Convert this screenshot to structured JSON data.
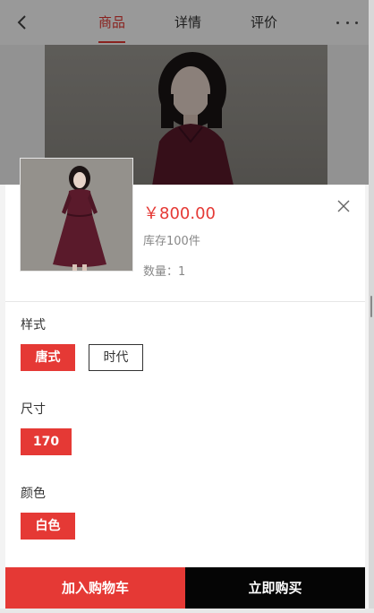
{
  "nav": {
    "tabs": [
      {
        "label": "商品",
        "active": true
      },
      {
        "label": "详情",
        "active": false
      },
      {
        "label": "评价",
        "active": false
      }
    ],
    "back_icon": "chevron-left-icon",
    "more_icon": "more-dots-icon"
  },
  "product": {
    "price": "￥800.00",
    "stock": "库存100件",
    "quantity_label": "数量：",
    "quantity_value": "1"
  },
  "sku_groups": [
    {
      "label": "样式",
      "options": [
        {
          "label": "唐式",
          "selected": true
        },
        {
          "label": "时代",
          "selected": false
        }
      ]
    },
    {
      "label": "尺寸",
      "options": [
        {
          "label": "170",
          "selected": true
        }
      ]
    },
    {
      "label": "颜色",
      "options": [
        {
          "label": "白色",
          "selected": true
        }
      ]
    }
  ],
  "actions": {
    "add_to_cart": "加入购物车",
    "buy_now": "立即购买"
  },
  "colors": {
    "accent": "#e53935",
    "buy_button": "#050505"
  }
}
